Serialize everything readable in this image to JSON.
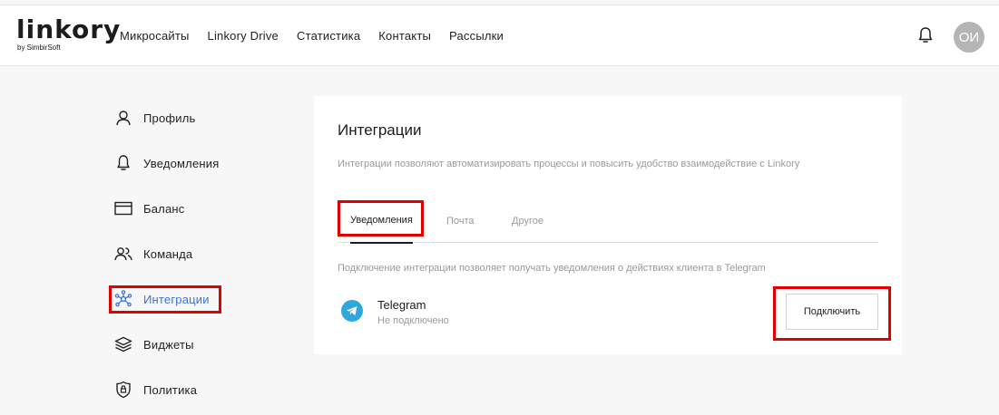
{
  "brand": {
    "logo_text": "linkory",
    "logo_sub": "by SimbirSoft"
  },
  "nav": {
    "items": [
      {
        "label": "Микросайты"
      },
      {
        "label": "Linkory Drive"
      },
      {
        "label": "Статистика"
      },
      {
        "label": "Контакты"
      },
      {
        "label": "Рассылки"
      }
    ]
  },
  "header_right": {
    "bell_icon": "bell-icon",
    "avatar_initials": "ОИ"
  },
  "sidebar": {
    "items": [
      {
        "label": "Профиль",
        "icon": "user-icon"
      },
      {
        "label": "Уведомления",
        "icon": "bell-icon"
      },
      {
        "label": "Баланс",
        "icon": "card-icon"
      },
      {
        "label": "Команда",
        "icon": "users-icon"
      },
      {
        "label": "Интеграции",
        "icon": "integrations-icon",
        "active": true
      },
      {
        "label": "Виджеты",
        "icon": "layers-icon"
      },
      {
        "label": "Политика",
        "icon": "shield-icon"
      }
    ]
  },
  "main": {
    "title": "Интеграции",
    "description": "Интеграции позволяют автоматизировать процессы и повысить удобство взаимодействие с Linkory",
    "tabs": [
      {
        "label": "Уведомления",
        "active": true
      },
      {
        "label": "Почта"
      },
      {
        "label": "Другое"
      }
    ],
    "section_note": "Подключение интеграции позволяет получать уведомления о действиях клиента в Telegram",
    "integration": {
      "icon": "telegram-icon",
      "name": "Telegram",
      "status": "Не подключено",
      "button_label": "Подключить"
    }
  },
  "colors": {
    "accent": "#3b73d9",
    "highlight": "#e00000",
    "telegram": "#2fa6de",
    "avatar_bg": "#b5b5b5"
  }
}
